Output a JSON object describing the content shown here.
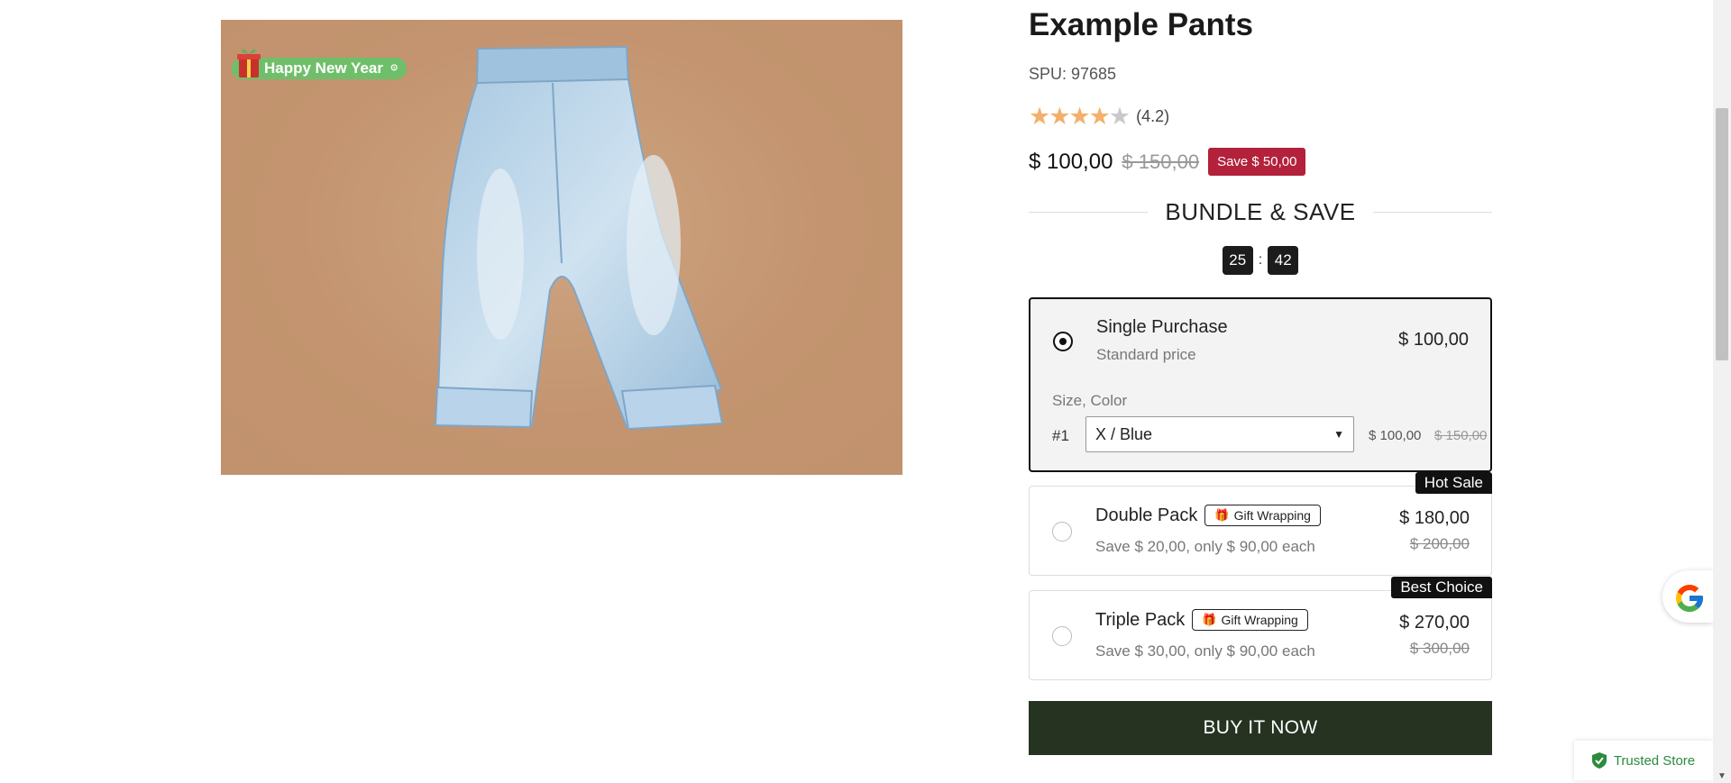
{
  "product": {
    "title": "Example Pants",
    "spu": "SPU: 97685",
    "rating": 4.2,
    "rating_text": "(4.2)",
    "price": "$ 100,00",
    "compare_price": "$ 150,00",
    "save_badge": "Save $ 50,00",
    "promo_badge": "Happy New Year",
    "promo_badge_dot": "⊙"
  },
  "bundle": {
    "heading": "BUNDLE & SAVE",
    "countdown": {
      "minutes": "25",
      "separator": ":",
      "seconds": "42"
    },
    "options": [
      {
        "name": "Single Purchase",
        "subtitle": "Standard price",
        "price": "$ 100,00",
        "selected": true,
        "variant_label": "Size, Color",
        "variant_index": "#1",
        "variant_value": "X / Blue",
        "variant_price": "$ 100,00",
        "variant_compare": "$ 150,00"
      },
      {
        "name": "Double Pack",
        "gift_tag": "Gift Wrapping",
        "subtitle": "Save $ 20,00, only $ 90,00 each",
        "price": "$ 180,00",
        "compare_price": "$ 200,00",
        "ribbon": "Hot Sale",
        "selected": false
      },
      {
        "name": "Triple Pack",
        "gift_tag": "Gift Wrapping",
        "subtitle": "Save $ 30,00, only $ 90,00 each",
        "price": "$ 270,00",
        "compare_price": "$ 300,00",
        "ribbon": "Best Choice",
        "selected": false
      }
    ]
  },
  "cta": {
    "buy_now": "BUY IT NOW"
  },
  "widgets": {
    "trusted_store": "Trusted Store",
    "google_icon": "google-g-icon"
  },
  "colors": {
    "save_badge": "#b3213a",
    "buy_button": "#253320",
    "star": "#f3b06c",
    "trusted": "#2c8a3e"
  }
}
